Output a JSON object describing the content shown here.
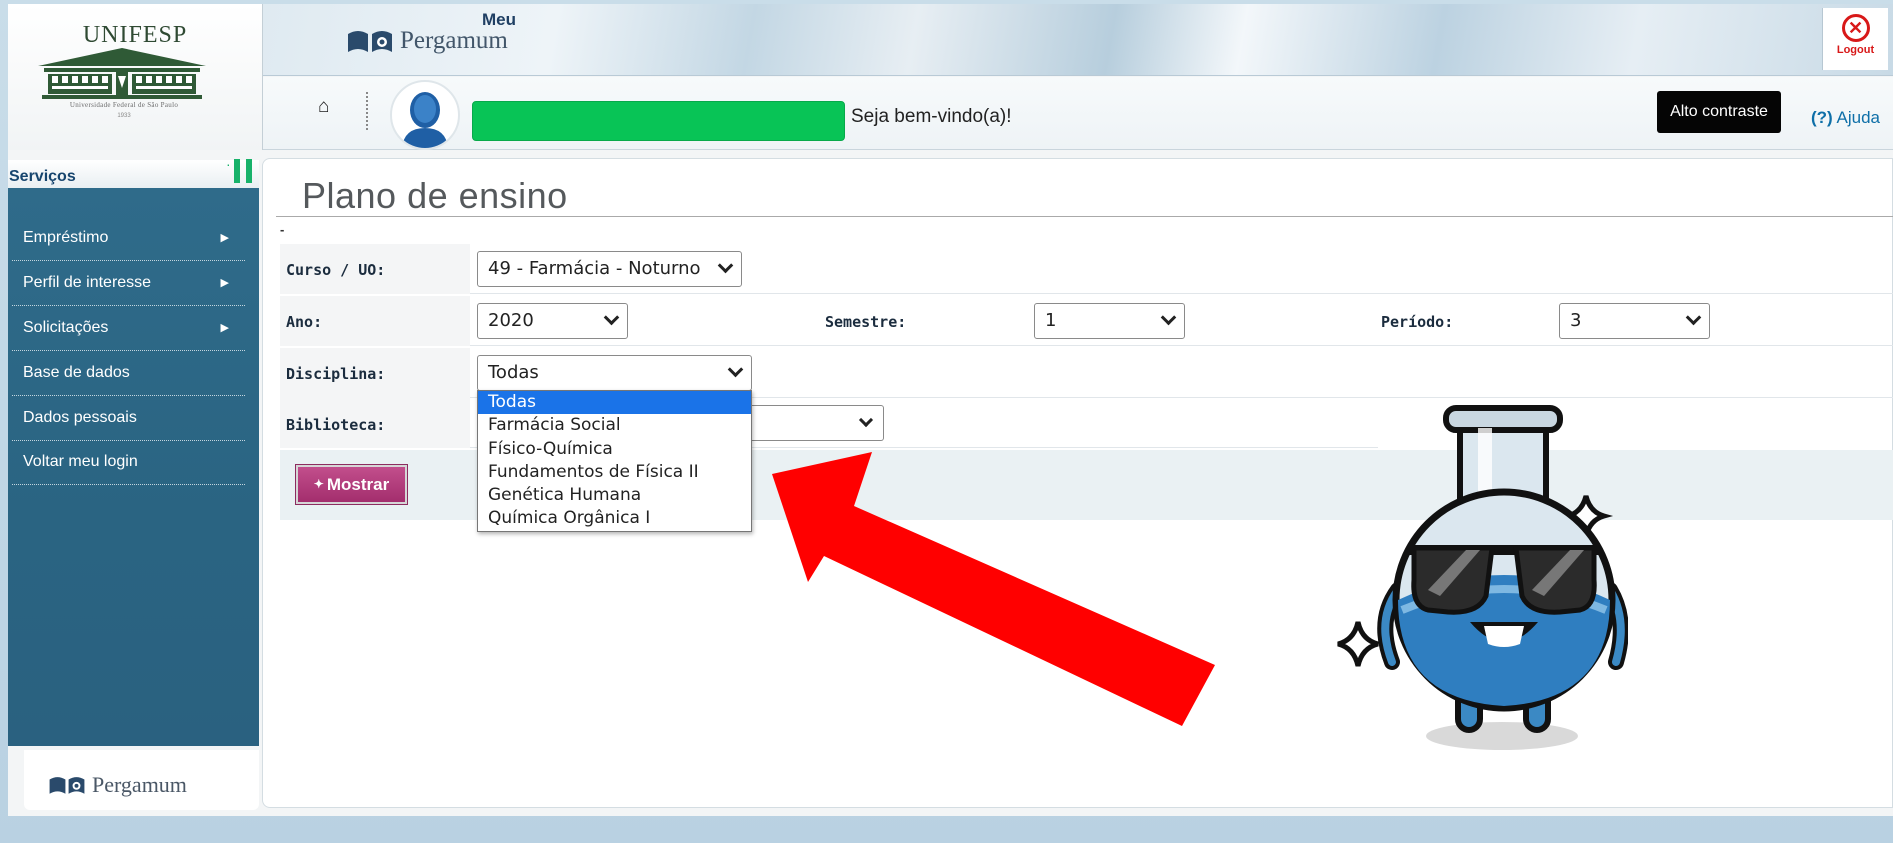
{
  "header": {
    "institution_name": "UNIFESP",
    "institution_full": "Universidade Federal de São Paulo",
    "institution_year": "1933",
    "app_prefix": "Meu",
    "app_name": "Pergamum",
    "logout_label": "Logout",
    "welcome": "Seja bem-vindo(a)!",
    "contrast_button": "Alto contraste",
    "help_icon": "(?)",
    "help_label": "Ajuda"
  },
  "sidebar": {
    "title": "Serviços",
    "items": [
      {
        "label": "Empréstimo",
        "arrow": "▶"
      },
      {
        "label": "Perfil de interesse",
        "arrow": "▶"
      },
      {
        "label": "Solicitações",
        "arrow": "▶"
      },
      {
        "label": "Base de dados",
        "arrow": ""
      },
      {
        "label": "Dados pessoais",
        "arrow": ""
      },
      {
        "label": "Voltar meu login",
        "arrow": ""
      }
    ],
    "footer_logo": "Pergamum"
  },
  "main": {
    "title": "Plano de ensino",
    "dash": "-",
    "form": {
      "curso_label": "Curso / UO:",
      "curso_value": "49 - Farmácia - Noturno",
      "ano_label": "Ano:",
      "ano_value": "2020",
      "semestre_label": "Semestre:",
      "semestre_value": "1",
      "periodo_label": "Período:",
      "periodo_value": "3",
      "disciplina_label": "Disciplina:",
      "disciplina_value": "Todas",
      "biblioteca_label": "Biblioteca:"
    },
    "disciplina_options": [
      "Todas",
      "Farmácia Social",
      "Físico-Química",
      "Fundamentos de Física II",
      "Genética Humana",
      "Química Orgânica I"
    ],
    "selected_option_index": 0,
    "show_button": "Mostrar",
    "show_button_icon": "✦"
  },
  "colors": {
    "sidebar_bg": "#2f6b8a",
    "button_bg": "#a32e6d",
    "username_highlight": "#08c456",
    "arrow_annotation": "#ff0000",
    "option_selected": "#1a73e8"
  }
}
